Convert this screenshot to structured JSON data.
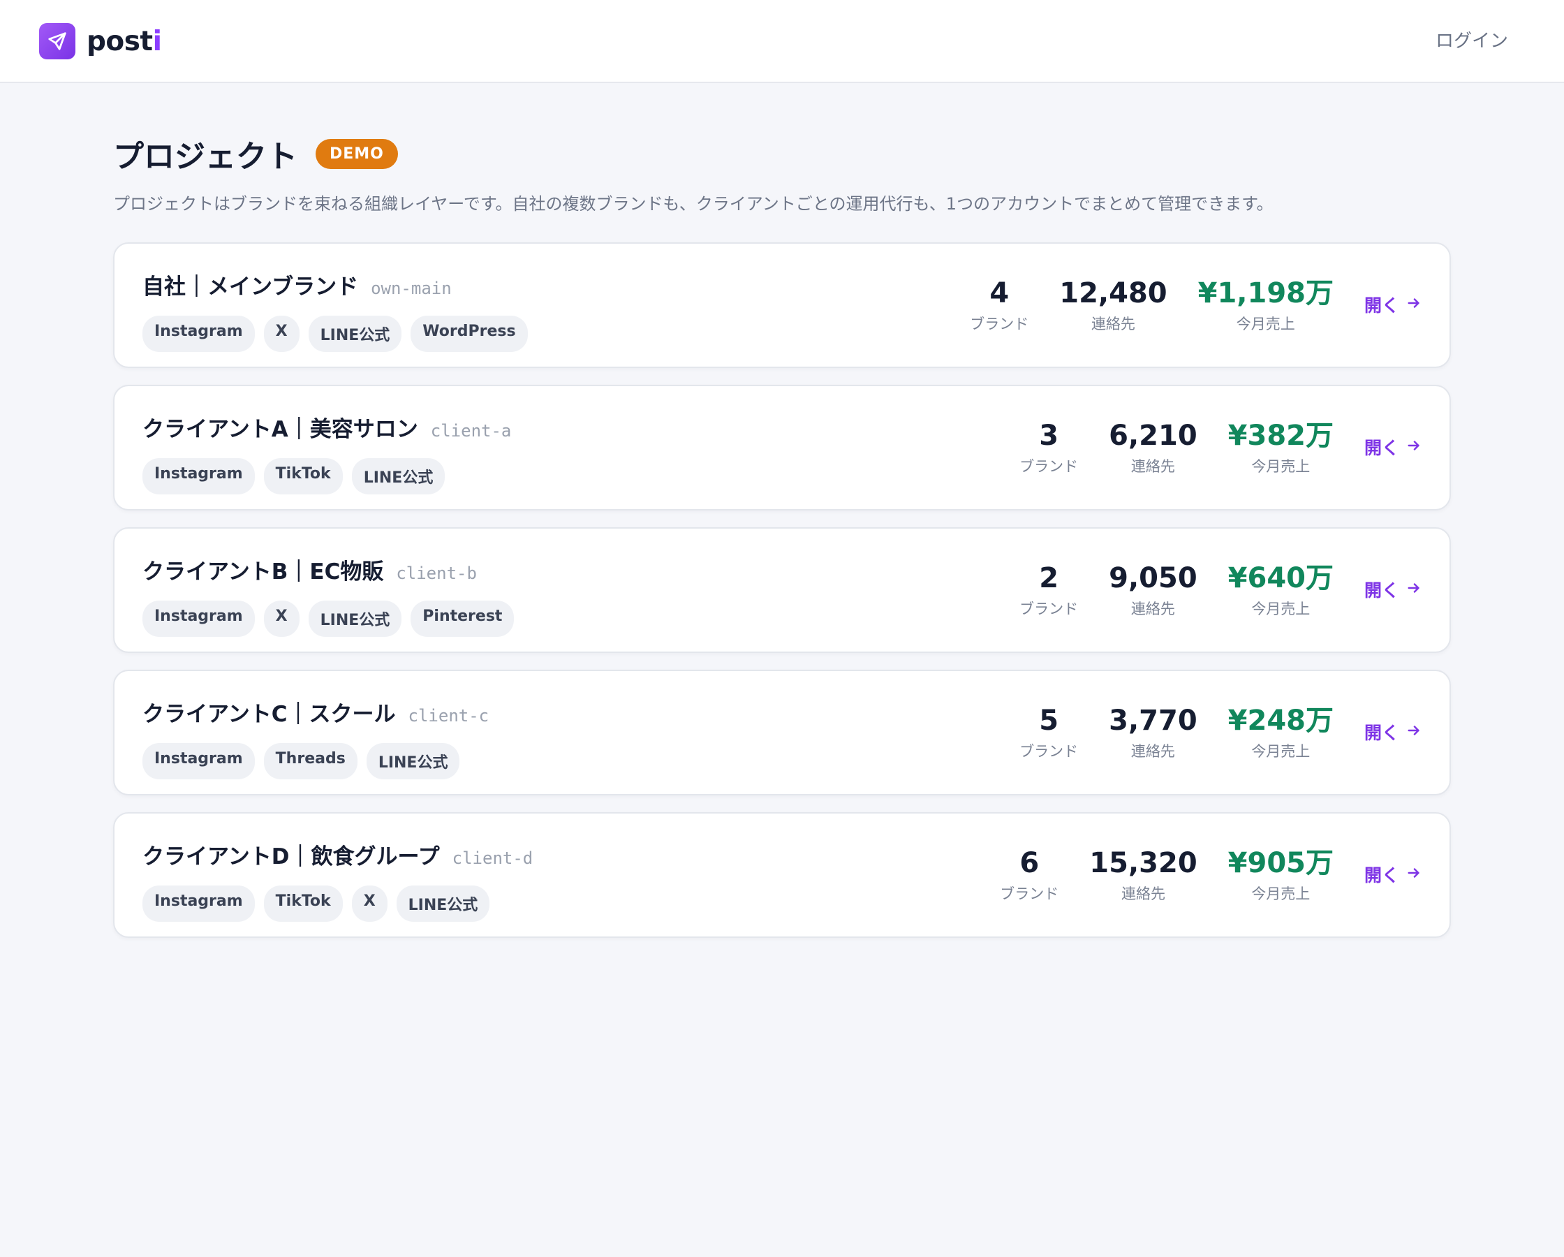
{
  "header": {
    "logo_text": "post",
    "logo_accent": "i",
    "login_label": "ログイン"
  },
  "page": {
    "title": "プロジェクト",
    "badge": "DEMO",
    "description": "プロジェクトはブランドを束ねる組織レイヤーです。自社の複数ブランドも、クライアントごとの運用代行も、1つのアカウントでまとめて管理できます。"
  },
  "labels": {
    "brands": "ブランド",
    "contacts": "連絡先",
    "sales": "今月売上",
    "open": "開く"
  },
  "projects": [
    {
      "name": "自社｜メインブランド",
      "slug": "own-main",
      "tags": [
        "Instagram",
        "X",
        "LINE公式",
        "WordPress"
      ],
      "brands": "4",
      "contacts": "12,480",
      "sales": "¥1,198万"
    },
    {
      "name": "クライアントA｜美容サロン",
      "slug": "client-a",
      "tags": [
        "Instagram",
        "TikTok",
        "LINE公式"
      ],
      "brands": "3",
      "contacts": "6,210",
      "sales": "¥382万"
    },
    {
      "name": "クライアントB｜EC物販",
      "slug": "client-b",
      "tags": [
        "Instagram",
        "X",
        "LINE公式",
        "Pinterest"
      ],
      "brands": "2",
      "contacts": "9,050",
      "sales": "¥640万"
    },
    {
      "name": "クライアントC｜スクール",
      "slug": "client-c",
      "tags": [
        "Instagram",
        "Threads",
        "LINE公式"
      ],
      "brands": "5",
      "contacts": "3,770",
      "sales": "¥248万"
    },
    {
      "name": "クライアントD｜飲食グループ",
      "slug": "client-d",
      "tags": [
        "Instagram",
        "TikTok",
        "X",
        "LINE公式"
      ],
      "brands": "6",
      "contacts": "15,320",
      "sales": "¥905万"
    }
  ],
  "colors": {
    "brand": "#8b3dff",
    "demo_badge": "#e07b10",
    "sales": "#11875c",
    "link": "#7e34e6"
  },
  "icons": {
    "logo": "paper-plane-icon",
    "open": "arrow-right-icon"
  }
}
